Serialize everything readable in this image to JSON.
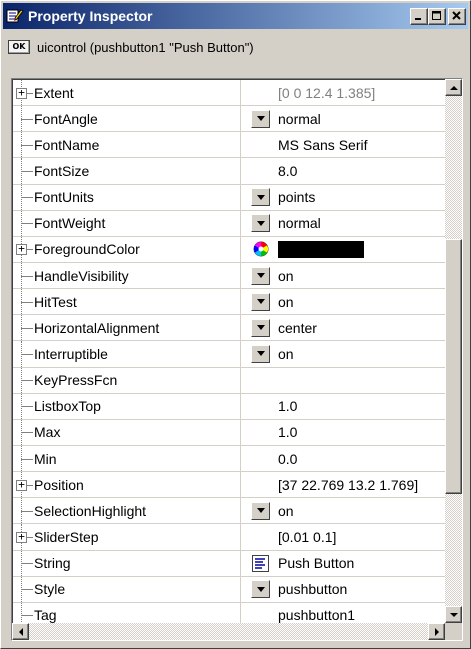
{
  "window": {
    "title": "Property Inspector",
    "object_label": "uicontrol (pushbutton1 \"Push Button\")",
    "ok_icon_text": "OK"
  },
  "colors": {
    "title_start": "#0a246a",
    "title_end": "#a6caf0",
    "foreground_swatch": "#000000"
  },
  "properties": [
    {
      "name": "Extent",
      "value": "[0 0 12.4 1.385]",
      "control": "none",
      "expandable": true,
      "dim": true
    },
    {
      "name": "FontAngle",
      "value": "normal",
      "control": "dropdown",
      "expandable": false
    },
    {
      "name": "FontName",
      "value": "MS Sans Serif",
      "control": "none",
      "expandable": false
    },
    {
      "name": "FontSize",
      "value": "8.0",
      "control": "none",
      "expandable": false
    },
    {
      "name": "FontUnits",
      "value": "points",
      "control": "dropdown",
      "expandable": false
    },
    {
      "name": "FontWeight",
      "value": "normal",
      "control": "dropdown",
      "expandable": false
    },
    {
      "name": "ForegroundColor",
      "value": "",
      "control": "color",
      "expandable": true
    },
    {
      "name": "HandleVisibility",
      "value": "on",
      "control": "dropdown",
      "expandable": false
    },
    {
      "name": "HitTest",
      "value": "on",
      "control": "dropdown",
      "expandable": false
    },
    {
      "name": "HorizontalAlignment",
      "value": "center",
      "control": "dropdown",
      "expandable": false
    },
    {
      "name": "Interruptible",
      "value": "on",
      "control": "dropdown",
      "expandable": false
    },
    {
      "name": "KeyPressFcn",
      "value": "",
      "control": "none",
      "expandable": false
    },
    {
      "name": "ListboxTop",
      "value": "1.0",
      "control": "none",
      "expandable": false
    },
    {
      "name": "Max",
      "value": "1.0",
      "control": "none",
      "expandable": false
    },
    {
      "name": "Min",
      "value": "0.0",
      "control": "none",
      "expandable": false
    },
    {
      "name": "Position",
      "value": "[37 22.769 13.2 1.769]",
      "control": "none",
      "expandable": true
    },
    {
      "name": "SelectionHighlight",
      "value": "on",
      "control": "dropdown",
      "expandable": false
    },
    {
      "name": "SliderStep",
      "value": "[0.01 0.1]",
      "control": "none",
      "expandable": true
    },
    {
      "name": "String",
      "value": "Push Button",
      "control": "text-editor",
      "expandable": false
    },
    {
      "name": "Style",
      "value": "pushbutton",
      "control": "dropdown",
      "expandable": false
    },
    {
      "name": "Tag",
      "value": "pushbutton1",
      "control": "none",
      "expandable": false
    }
  ],
  "icons": {
    "title": "property-inspector-icon",
    "minimize": "minimize-icon",
    "maximize": "maximize-icon",
    "close": "close-icon",
    "color_picker": "color-wheel-icon",
    "text_editor": "text-editor-icon"
  }
}
